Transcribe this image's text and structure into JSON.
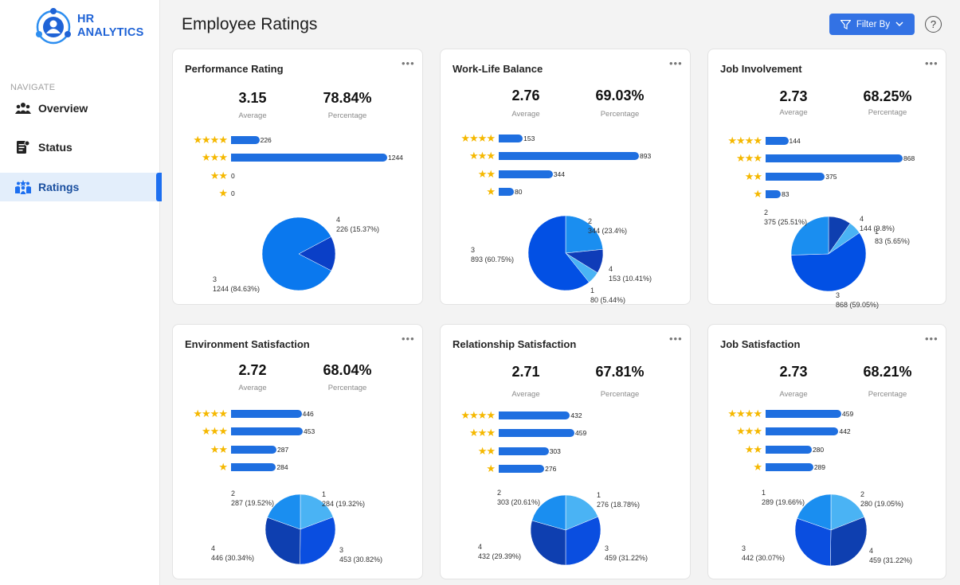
{
  "app": {
    "logo_line1": "HR",
    "logo_line2": "ANALYTICS"
  },
  "sidebar": {
    "caption": "NAVIGATE",
    "items": [
      {
        "label": "Overview",
        "icon": "users-icon"
      },
      {
        "label": "Status",
        "icon": "document-icon"
      },
      {
        "label": "Ratings",
        "icon": "team-star-icon",
        "active": true
      }
    ]
  },
  "header": {
    "title": "Employee Ratings",
    "filter_label": "Filter By",
    "help_label": "?"
  },
  "colors": {
    "accent": "#1f6fe0",
    "star": "#f5b800",
    "pie": [
      "#0057e7",
      "#1c44c4",
      "#1e8ff2",
      "#4ab3f4",
      "#0e3fb0"
    ]
  },
  "cards": [
    {
      "title": "Performance Rating",
      "more": "•••",
      "avg": "3.15",
      "avg_label": "Average",
      "pct": "78.84%",
      "pct_label": "Percentage",
      "bars": [
        {
          "stars": "★★★★",
          "value": 226,
          "label": "226"
        },
        {
          "stars": "★★★",
          "value": 1244,
          "label": "1244"
        },
        {
          "stars": "★★",
          "value": 0,
          "label": "0"
        },
        {
          "stars": "★",
          "value": 0,
          "label": "0"
        }
      ],
      "pie": [
        {
          "rating": "4",
          "text": "226 (15.37%)",
          "pct": 15.37
        },
        {
          "rating": "3",
          "text": "1244 (84.63%)",
          "pct": 84.63
        }
      ]
    },
    {
      "title": "Work-Life Balance",
      "more": "•••",
      "avg": "2.76",
      "avg_label": "Average",
      "pct": "69.03%",
      "pct_label": "Percentage",
      "bars": [
        {
          "stars": "★★★★",
          "value": 153,
          "label": "153"
        },
        {
          "stars": "★★★",
          "value": 893,
          "label": "893"
        },
        {
          "stars": "★★",
          "value": 344,
          "label": "344"
        },
        {
          "stars": "★",
          "value": 80,
          "label": "80"
        }
      ],
      "pie": [
        {
          "rating": "2",
          "text": "344 (23.4%)",
          "pct": 23.4
        },
        {
          "rating": "4",
          "text": "153 (10.41%)",
          "pct": 10.41
        },
        {
          "rating": "1",
          "text": "80 (5.44%)",
          "pct": 5.44
        },
        {
          "rating": "3",
          "text": "893 (60.75%)",
          "pct": 60.75
        }
      ]
    },
    {
      "title": "Job Involvement",
      "more": "•••",
      "avg": "2.73",
      "avg_label": "Average",
      "pct": "68.25%",
      "pct_label": "Percentage",
      "bars": [
        {
          "stars": "★★★★",
          "value": 144,
          "label": "144"
        },
        {
          "stars": "★★★",
          "value": 868,
          "label": "868"
        },
        {
          "stars": "★★",
          "value": 375,
          "label": "375"
        },
        {
          "stars": "★",
          "value": 83,
          "label": "83"
        }
      ],
      "pie": [
        {
          "rating": "4",
          "text": "144 (9.8%)",
          "pct": 9.8
        },
        {
          "rating": "1",
          "text": "83 (5.65%)",
          "pct": 5.65
        },
        {
          "rating": "3",
          "text": "868 (59.05%)",
          "pct": 59.05
        },
        {
          "rating": "2",
          "text": "375 (25.51%)",
          "pct": 25.51
        }
      ]
    },
    {
      "title": "Environment Satisfaction",
      "more": "•••",
      "avg": "2.72",
      "avg_label": "Average",
      "pct": "68.04%",
      "pct_label": "Percentage",
      "bars": [
        {
          "stars": "★★★★",
          "value": 446,
          "label": "446"
        },
        {
          "stars": "★★★",
          "value": 453,
          "label": "453"
        },
        {
          "stars": "★★",
          "value": 287,
          "label": "287"
        },
        {
          "stars": "★",
          "value": 284,
          "label": "284"
        }
      ],
      "pie": [
        {
          "rating": "1",
          "text": "284 (19.32%)",
          "pct": 19.32
        },
        {
          "rating": "3",
          "text": "453 (30.82%)",
          "pct": 30.82
        },
        {
          "rating": "4",
          "text": "446 (30.34%)",
          "pct": 30.34
        },
        {
          "rating": "2",
          "text": "287 (19.52%)",
          "pct": 19.52
        }
      ]
    },
    {
      "title": "Relationship Satisfaction",
      "more": "•••",
      "avg": "2.71",
      "avg_label": "Average",
      "pct": "67.81%",
      "pct_label": "Percentage",
      "bars": [
        {
          "stars": "★★★★",
          "value": 432,
          "label": "432"
        },
        {
          "stars": "★★★",
          "value": 459,
          "label": "459"
        },
        {
          "stars": "★★",
          "value": 303,
          "label": "303"
        },
        {
          "stars": "★",
          "value": 276,
          "label": "276"
        }
      ],
      "pie": [
        {
          "rating": "1",
          "text": "276 (18.78%)",
          "pct": 18.78
        },
        {
          "rating": "3",
          "text": "459 (31.22%)",
          "pct": 31.22
        },
        {
          "rating": "4",
          "text": "432 (29.39%)",
          "pct": 29.39
        },
        {
          "rating": "2",
          "text": "303 (20.61%)",
          "pct": 20.61
        }
      ]
    },
    {
      "title": "Job Satisfaction",
      "more": "•••",
      "avg": "2.73",
      "avg_label": "Average",
      "pct": "68.21%",
      "pct_label": "Percentage",
      "bars": [
        {
          "stars": "★★★★",
          "value": 459,
          "label": "459"
        },
        {
          "stars": "★★★",
          "value": 442,
          "label": "442"
        },
        {
          "stars": "★★",
          "value": 280,
          "label": "280"
        },
        {
          "stars": "★",
          "value": 289,
          "label": "289"
        }
      ],
      "pie": [
        {
          "rating": "2",
          "text": "280 (19.05%)",
          "pct": 19.05
        },
        {
          "rating": "4",
          "text": "459 (31.22%)",
          "pct": 31.22
        },
        {
          "rating": "3",
          "text": "442 (30.07%)",
          "pct": 30.07
        },
        {
          "rating": "1",
          "text": "289 (19.66%)",
          "pct": 19.66
        }
      ]
    }
  ]
}
